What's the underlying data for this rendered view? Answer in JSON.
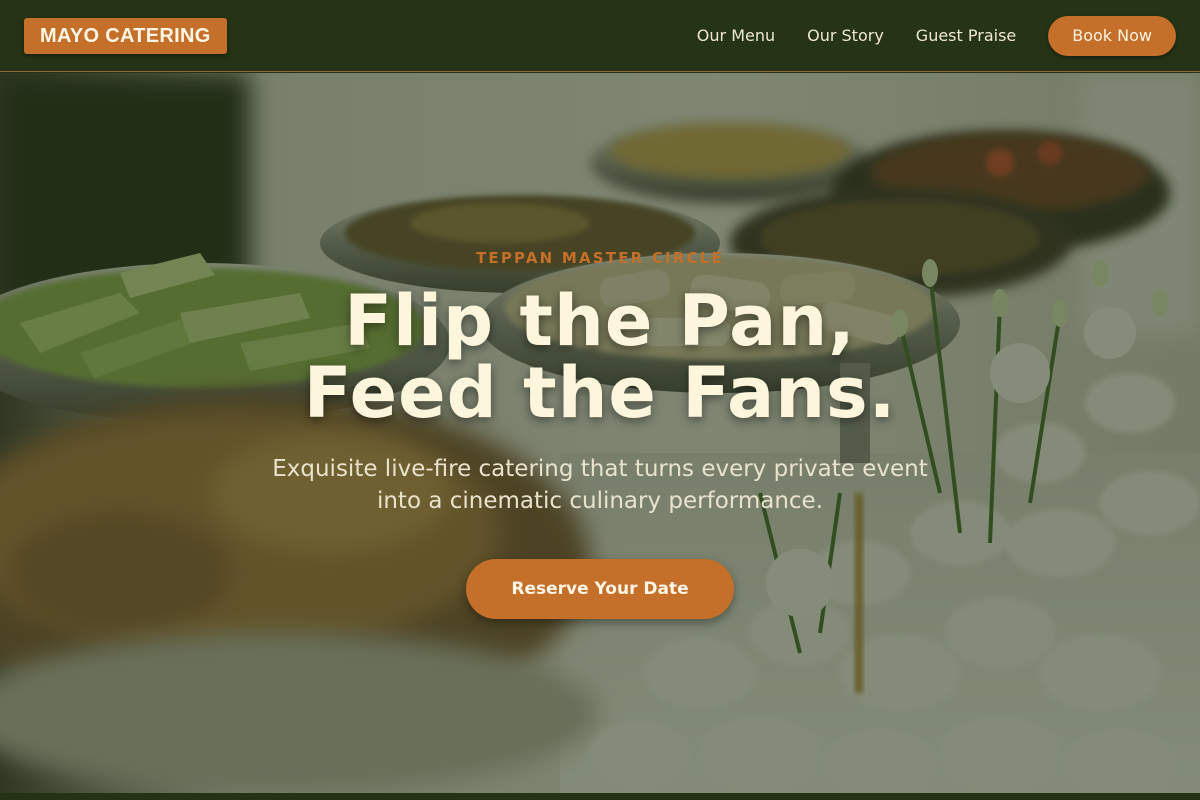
{
  "header": {
    "logo_text": "MAYO CATERING",
    "nav": [
      {
        "label": "Our Menu"
      },
      {
        "label": "Our Story"
      },
      {
        "label": "Guest Praise"
      }
    ],
    "book_button": "Book Now"
  },
  "hero": {
    "eyebrow": "TEPPAN MASTER CIRCLE",
    "headline_line1": "Flip the Pan,",
    "headline_line2": "Feed the Fans.",
    "subtitle": "Exquisite live-fire catering that turns every private event into a cinematic culinary performance.",
    "cta": "Reserve Your Date"
  },
  "colors": {
    "header_bg": "#253316",
    "accent": "#c46f2a",
    "headline": "#fdf5dc",
    "overlay": "#283719"
  }
}
